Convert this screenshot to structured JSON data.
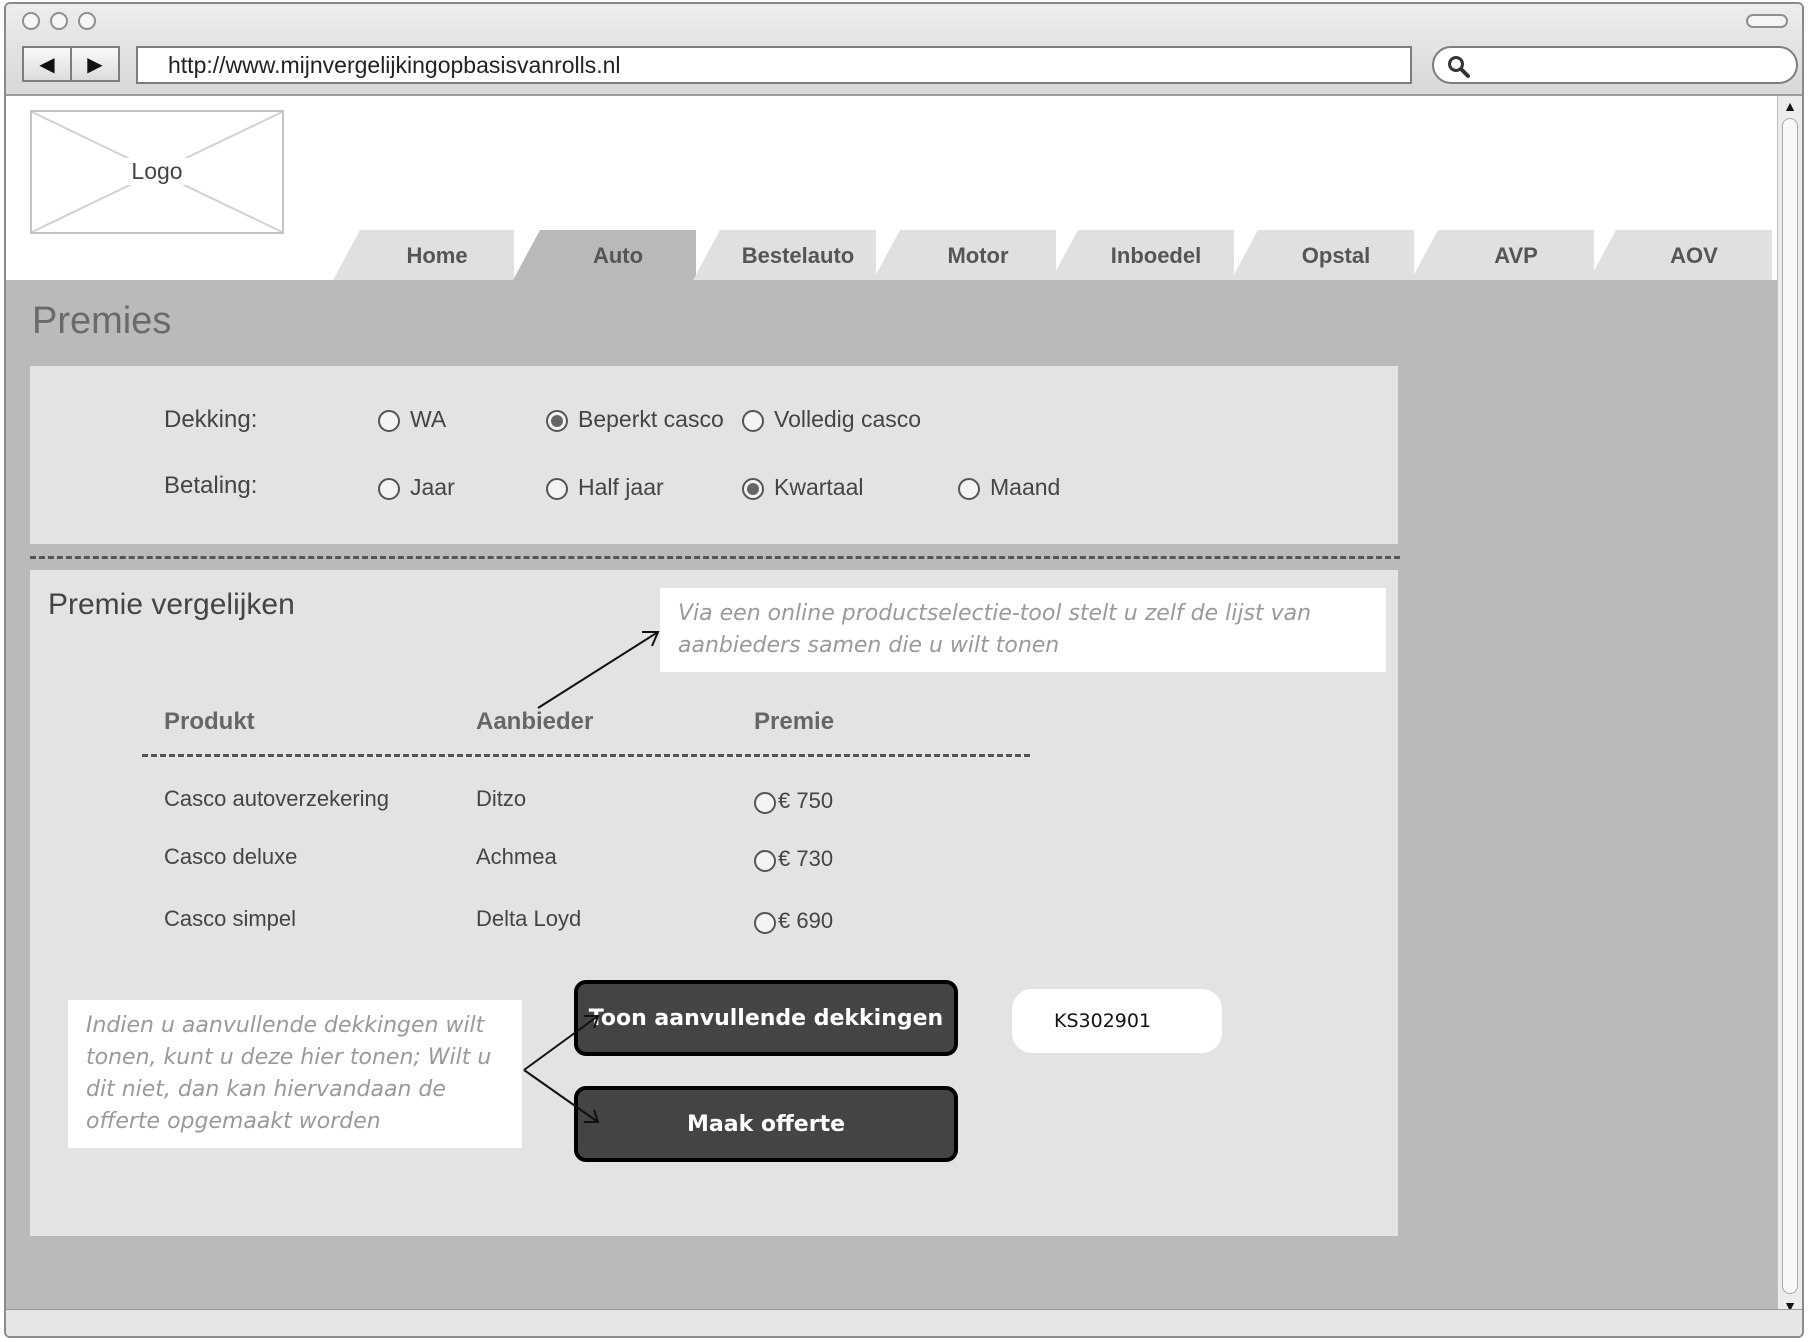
{
  "browser": {
    "url": "http://www.mijnvergelijkingopbasisvanrolls.nl",
    "back_glyph": "◀",
    "forward_glyph": "▶"
  },
  "header": {
    "logo_label": "Logo",
    "tabs": [
      {
        "label": "Home",
        "active": false
      },
      {
        "label": "Auto",
        "active": true
      },
      {
        "label": "Bestelauto",
        "active": false
      },
      {
        "label": "Motor",
        "active": false
      },
      {
        "label": "Inboedel",
        "active": false
      },
      {
        "label": "Opstal",
        "active": false
      },
      {
        "label": "AVP",
        "active": false
      },
      {
        "label": "AOV",
        "active": false
      }
    ]
  },
  "main": {
    "title": "Premies",
    "filters": {
      "dekking": {
        "label": "Dekking:",
        "options": [
          "WA",
          "Beperkt casco",
          "Volledig casco"
        ],
        "selected": "Beperkt casco"
      },
      "betaling": {
        "label": "Betaling:",
        "options": [
          "Jaar",
          "Half jaar",
          "Kwartaal",
          "Maand"
        ],
        "selected": "Kwartaal"
      }
    },
    "compare": {
      "title": "Premie vergelijken",
      "note_top": "Via een online productselectie-tool stelt u zelf de lijst van aanbieders samen die u wilt tonen",
      "columns": [
        "Produkt",
        "Aanbieder",
        "Premie"
      ],
      "rows": [
        {
          "produkt": "Casco autoverzekering",
          "aanbieder": "Ditzo",
          "premie": "€ 750"
        },
        {
          "produkt": "Casco deluxe",
          "aanbieder": "Achmea",
          "premie": "€ 730"
        },
        {
          "produkt": "Casco simpel",
          "aanbieder": "Delta Loyd",
          "premie": "€ 690"
        }
      ],
      "note_bottom": "Indien u aanvullende dekkingen wilt tonen, kunt u deze hier tonen; Wilt u dit niet, dan kan hiervandaan de offerte opgemaakt worden",
      "btn_extra": "Toon aanvullende dekkingen",
      "btn_quote": "Maak offerte",
      "code": "KS302901"
    }
  },
  "colors": {
    "content_bg": "#bababa",
    "panel_bg": "#e3e3e3",
    "button_bg": "#444444"
  }
}
